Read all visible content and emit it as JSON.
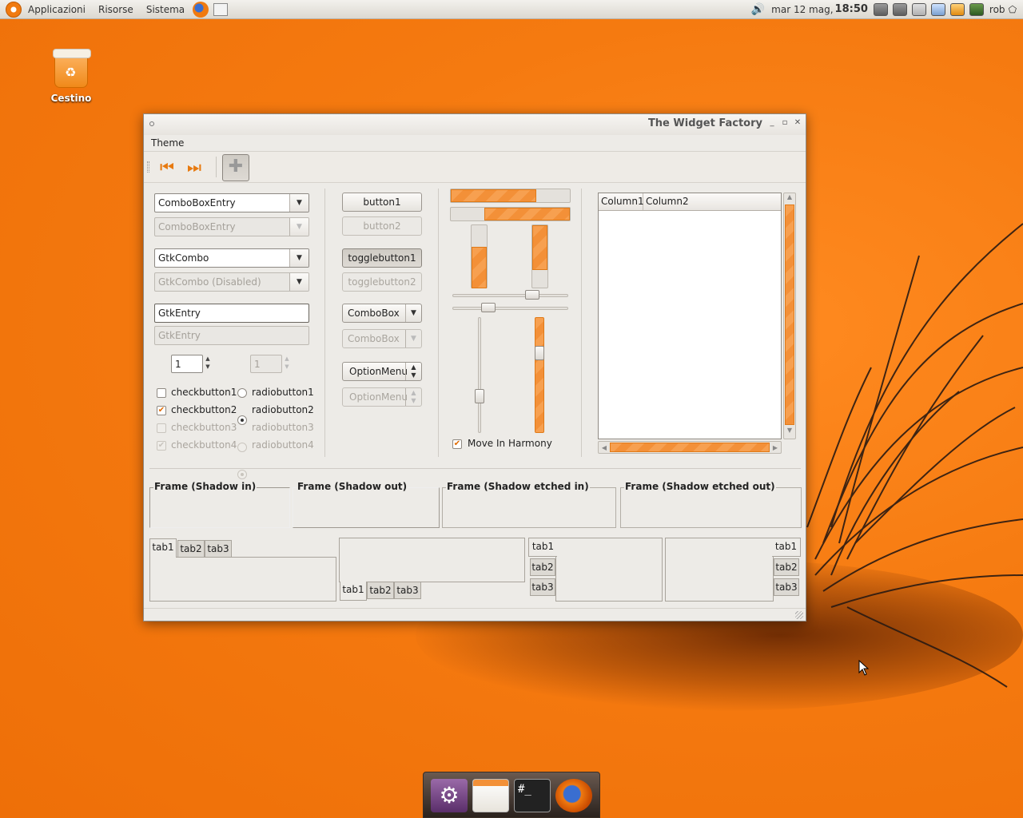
{
  "top_panel": {
    "menus": [
      "Applicazioni",
      "Risorse",
      "Sistema"
    ],
    "clock_date": "mar 12 mag,",
    "clock_time": "18:50",
    "user": "rob"
  },
  "desktop": {
    "trash_label": "Cestino"
  },
  "window": {
    "title": "The Widget Factory",
    "menu_theme": "Theme",
    "column1": {
      "combo_entry": "ComboBoxEntry",
      "combo_entry_disabled": "ComboBoxEntry",
      "gtk_combo": "GtkCombo",
      "gtk_combo_disabled": "GtkCombo (Disabled)",
      "gtk_entry": "GtkEntry",
      "gtk_entry_disabled": "GtkEntry",
      "spin_value": "1",
      "spin_value_disabled": "1",
      "checkbuttons": [
        "checkbutton1",
        "checkbutton2",
        "checkbutton3",
        "checkbutton4"
      ],
      "radiobuttons": [
        "radiobutton1",
        "radiobutton2",
        "radiobutton3",
        "radiobutton4"
      ]
    },
    "column2": {
      "button1": "button1",
      "button2": "button2",
      "toggle1": "togglebutton1",
      "toggle2": "togglebutton2",
      "combobox": "ComboBox",
      "combobox_disabled": "ComboBox",
      "optionmenu": "OptionMenu",
      "optionmenu_disabled": "OptionMenu"
    },
    "column3": {
      "move_in_harmony": "Move In Harmony"
    },
    "tree": {
      "col1": "Column1",
      "col2": "Column2"
    },
    "frames": [
      "Frame (Shadow in)",
      "Frame (Shadow out)",
      "Frame (Shadow etched in)",
      "Frame (Shadow etched out)"
    ],
    "tabs": [
      "tab1",
      "tab2",
      "tab3"
    ]
  },
  "colors": {
    "accent": "#f39038",
    "desktop": "#f57a10"
  }
}
